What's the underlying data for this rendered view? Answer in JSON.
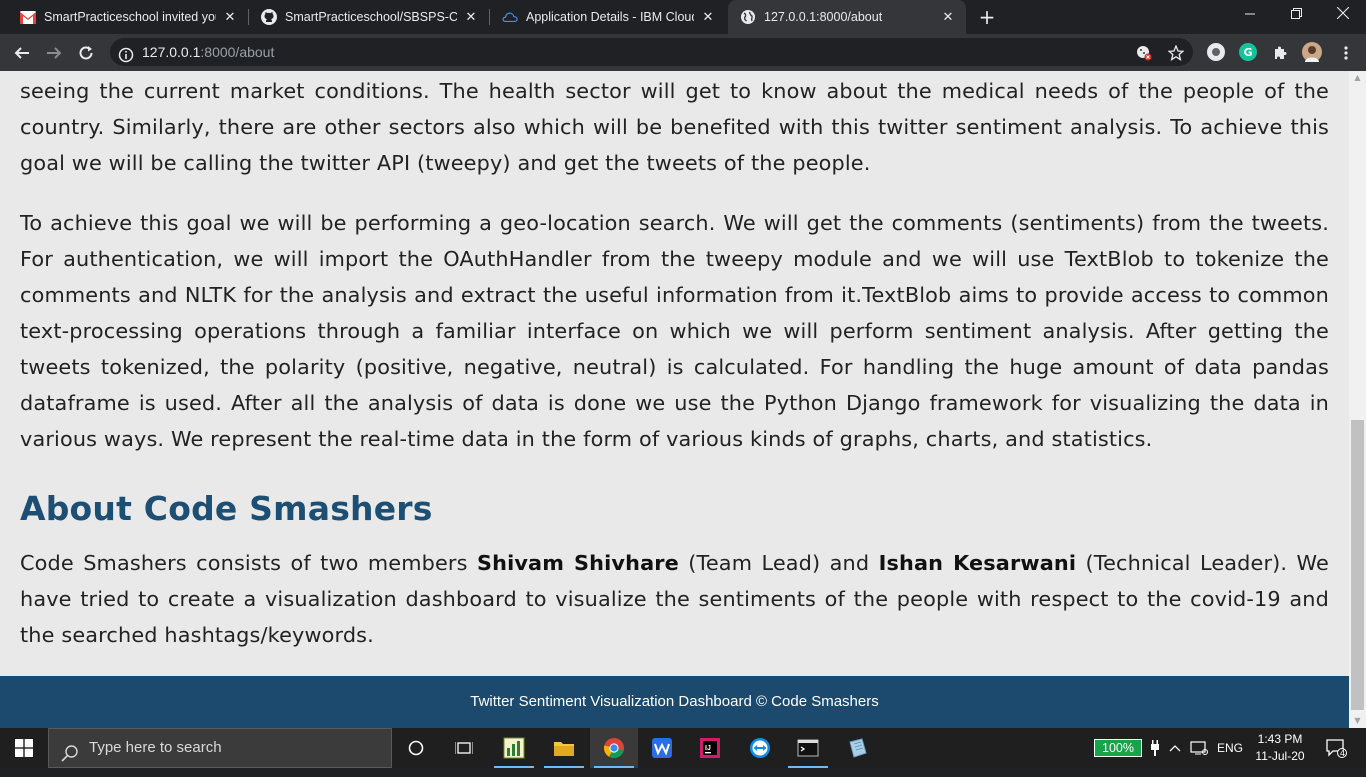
{
  "browser": {
    "tabs": [
      {
        "title": "SmartPracticeschool invited you t",
        "icon": "gmail-icon"
      },
      {
        "title": "SmartPracticeschool/SBSPS-Chall",
        "icon": "github-icon"
      },
      {
        "title": "Application Details - IBM Cloud",
        "icon": "ibm-cloud-icon"
      },
      {
        "title": "127.0.0.1:8000/about",
        "icon": "globe-icon"
      }
    ],
    "new_tab": "+",
    "url_host": "127.0.0.1",
    "url_rest": ":8000/about"
  },
  "page": {
    "para1": "seeing the current market conditions. The health sector will get to know about the medical needs of the people of the country. Similarly, there are other sectors also which will be benefited with this twitter sentiment analysis. To achieve this goal we will be calling the twitter API (tweepy) and get the tweets of the people.",
    "para2": "To achieve this goal we will be performing a geo-location search. We will get the comments (sentiments) from the tweets. For authentication, we will import the OAuthHandler from the tweepy module and we will use TextBlob to tokenize the comments and NLTK for the analysis and extract the useful information from it.TextBlob aims to provide access to common text-processing operations through a familiar interface on which we will perform sentiment analysis. After getting the tweets tokenized, the polarity (positive, negative, neutral) is calculated. For handling the huge amount of data pandas dataframe is used. After all the analysis of data is done we use the Python Django framework for visualizing the data in various ways. We represent the real-time data in the form of various kinds of graphs, charts, and statistics.",
    "heading": "About Code Smashers",
    "para3": {
      "t1": "Code Smashers consists of two members ",
      "member1": "Shivam Shivhare",
      "t2": " (Team Lead) and ",
      "member2": "Ishan Kesarwani",
      "t3": " (Technical Leader). We have tried to create a visualization dashboard to visualize the sentiments of the people with respect to the covid-19 and the searched hashtags/keywords."
    },
    "footer": "Twitter Sentiment Visualization Dashboard © Code Smashers"
  },
  "taskbar": {
    "search_placeholder": "Type here to search",
    "battery": "100%",
    "language": "ENG",
    "time": "1:43 PM",
    "date": "11-Jul-20",
    "notifications": "4"
  },
  "colors": {
    "heading": "#1d4e73",
    "footer_bg": "#1c4a6e",
    "page_bg": "#e9e9e9",
    "battery": "#16a34a"
  }
}
